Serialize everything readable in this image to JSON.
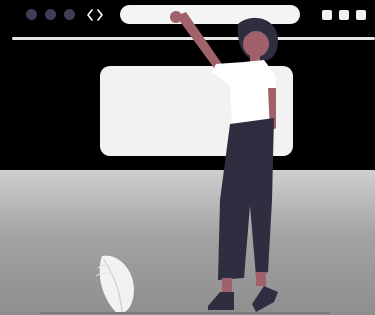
{
  "browser": {
    "window_dots": [
      {
        "icon": "window-dot-icon"
      },
      {
        "icon": "window-dot-icon"
      },
      {
        "icon": "window-dot-icon"
      }
    ],
    "nav_icons": [
      "back-arrow-icon",
      "forward-arrow-icon"
    ],
    "url_value": "",
    "window_controls": [
      "window-control-icon",
      "window-control-icon",
      "window-control-icon"
    ]
  },
  "illustration": {
    "subject": "person-pointing-at-browser",
    "decorations": [
      "leaf-plant-icon"
    ]
  },
  "colors": {
    "chrome_background": "#000000",
    "dot": "#3f3d56",
    "card": "#f2f2f2",
    "url_bar": "#f4f4f4",
    "shirt": "#ffffff",
    "pants": "#2f2e41",
    "skin": "#a0616a",
    "hair": "#2f2e41"
  }
}
